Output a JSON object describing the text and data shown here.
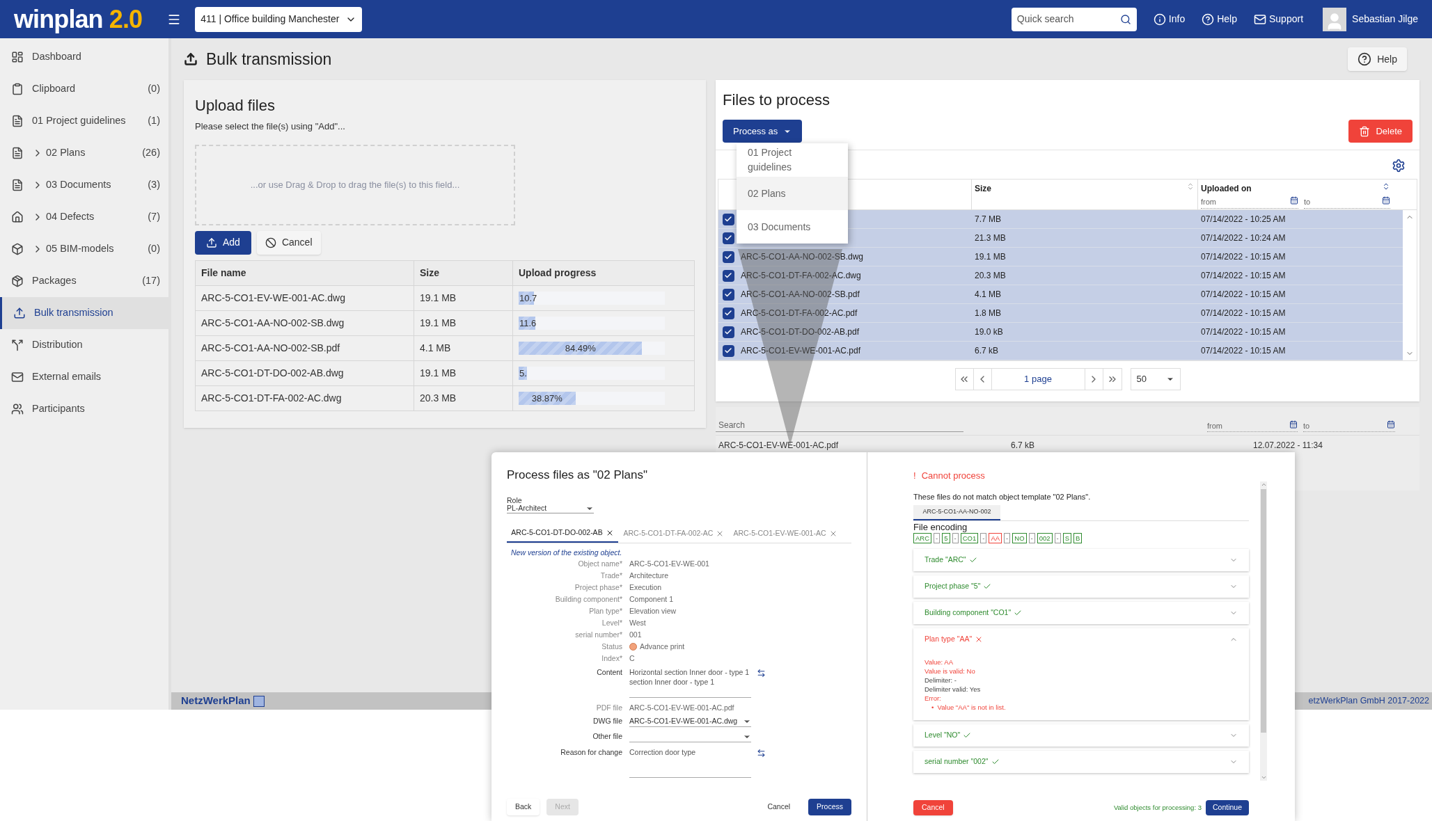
{
  "header": {
    "logo": "winplan",
    "logo_version": "2.0",
    "project": "411 | Office building Manchester",
    "search_placeholder": "Quick search",
    "links": [
      "Info",
      "Help",
      "Support"
    ],
    "user": "Sebastian Jilge"
  },
  "sidebar": {
    "items": [
      {
        "label": "Dashboard",
        "expandable": false,
        "selected": false
      },
      {
        "label": "Clipboard",
        "count": "(0)",
        "expandable": false,
        "selected": false
      },
      {
        "label": "01 Project guidelines",
        "count": "(1)",
        "expandable": false,
        "selected": false
      },
      {
        "label": "02 Plans",
        "count": "(26)",
        "expandable": true,
        "selected": false
      },
      {
        "label": "03 Documents",
        "count": "(3)",
        "expandable": true,
        "selected": false
      },
      {
        "label": "04 Defects",
        "count": "(7)",
        "expandable": true,
        "selected": false
      },
      {
        "label": "05 BIM-models",
        "count": "(0)",
        "expandable": true,
        "selected": false
      },
      {
        "label": "Packages",
        "count": "(17)",
        "expandable": false,
        "selected": false
      },
      {
        "label": "Bulk transmission",
        "expandable": false,
        "selected": true
      },
      {
        "label": "Distribution",
        "expandable": false,
        "selected": false
      },
      {
        "label": "External emails",
        "expandable": false,
        "selected": false
      },
      {
        "label": "Participants",
        "expandable": false,
        "selected": false
      }
    ]
  },
  "page": {
    "title": "Bulk transmission",
    "help": "Help"
  },
  "upload": {
    "title": "Upload files",
    "hint": "Please select the file(s) using \"Add\"...",
    "drop_text": "...or use Drag & Drop to drag the file(s) to this field...",
    "add": "Add",
    "cancel": "Cancel",
    "columns": [
      "File name",
      "Size",
      "Upload progress"
    ],
    "rows": [
      {
        "name": "ARC-5-CO1-EV-WE-001-AC.dwg",
        "size": "19.1 MB",
        "level": 0.107,
        "reading": "10.7"
      },
      {
        "name": "ARC-5-CO1-AA-NO-002-SB.dwg",
        "size": "19.1 MB",
        "level": 0.116,
        "reading": "11.6"
      },
      {
        "name": "ARC-5-CO1-AA-NO-002-SB.pdf",
        "size": "4.1 MB",
        "level": 0.8449,
        "reading": "84.49%"
      },
      {
        "name": "ARC-5-CO1-DT-DO-002-AB.dwg",
        "size": "19.1 MB",
        "level": 0.059,
        "reading": "5."
      },
      {
        "name": "ARC-5-CO1-DT-FA-002-AC.dwg",
        "size": "20.3 MB",
        "level": 0.3887,
        "reading": "38.87%"
      }
    ]
  },
  "files": {
    "title": "Files to process",
    "process_as": "Process as",
    "delete": "Delete",
    "columns": [
      {
        "label": "Size"
      },
      {
        "label": "Uploaded on",
        "from": "from",
        "to": "to"
      }
    ],
    "rows": [
      {
        "checked": true,
        "size": "7.7 MB",
        "uploaded": "07/14/2022 - 10:25 AM"
      },
      {
        "checked": true,
        "size": "21.3 MB",
        "uploaded": "07/14/2022 - 10:24 AM"
      },
      {
        "checked": true,
        "name": "ARC-5-CO1-AA-NO-002-SB.dwg",
        "size": "19.1 MB",
        "uploaded": "07/14/2022 - 10:15 AM"
      },
      {
        "checked": true,
        "name": "ARC-5-CO1-DT-FA-002-AC.dwg",
        "size": "20.3 MB",
        "uploaded": "07/14/2022 - 10:15 AM"
      },
      {
        "checked": true,
        "name": "ARC-5-CO1-AA-NO-002-SB.pdf",
        "size": "4.1 MB",
        "uploaded": "07/14/2022 - 10:15 AM"
      },
      {
        "checked": true,
        "name": "ARC-5-CO1-DT-FA-002-AC.pdf",
        "size": "1.8 MB",
        "uploaded": "07/14/2022 - 10:15 AM"
      },
      {
        "checked": true,
        "name": "ARC-5-CO1-DT-DO-002-AB.pdf",
        "size": "19.0 kB",
        "uploaded": "07/14/2022 - 10:15 AM"
      },
      {
        "checked": true,
        "name": "ARC-5-CO1-EV-WE-001-AC.pdf",
        "size": "6.7 kB",
        "uploaded": "07/14/2022 - 10:15 AM"
      }
    ],
    "pager": "1 page",
    "page_size": "50"
  },
  "process_menu": [
    {
      "label": "01 Project guidelines",
      "selected": false
    },
    {
      "label": "02 Plans",
      "selected": true
    },
    {
      "label": "03 Documents",
      "selected": false
    }
  ],
  "background_table": {
    "search_placeholder": "Search",
    "from": "from",
    "to": "to",
    "row": {
      "name": "ARC-5-CO1-EV-WE-001-AC.pdf",
      "size": "6.7 kB",
      "uploaded": "12.07.2022 - 11:34"
    }
  },
  "dialog": {
    "title": "Process files as \"02 Plans\"",
    "role_label": "Role",
    "role": "PL-Architect",
    "tabs": [
      {
        "label": "ARC-5-CO1-DT-DO-002-AB",
        "selected": true
      },
      {
        "label": "ARC-5-CO1-DT-FA-002-AC",
        "selected": false
      },
      {
        "label": "ARC-5-CO1-EV-WE-001-AC",
        "selected": false
      }
    ],
    "note": "New version of the existing object.",
    "fields": [
      {
        "kind": "text",
        "label": "Object name*",
        "value": "ARC-5-CO1-EV-WE-001"
      },
      {
        "kind": "text",
        "label": "Trade*",
        "value": "Architecture"
      },
      {
        "kind": "text",
        "label": "Project phase*",
        "value": "Execution"
      },
      {
        "kind": "text",
        "label": "Building component*",
        "value": "Component 1"
      },
      {
        "kind": "text",
        "label": "Plan type*",
        "value": "Elevation view"
      },
      {
        "kind": "text",
        "label": "Level*",
        "value": "West"
      },
      {
        "kind": "text",
        "label": "serial number*",
        "value": "001"
      },
      {
        "kind": "status",
        "label": "Status",
        "value": "Advance print"
      },
      {
        "kind": "text",
        "label": "Index*",
        "value": "C"
      },
      {
        "kind": "textarea",
        "label": "Content",
        "value": "Horizontal section Inner door - type 1\nsection Inner door - type 1"
      },
      {
        "kind": "text",
        "label": "PDF file",
        "value": "ARC-5-CO1-EV-WE-001-AC.pdf"
      },
      {
        "kind": "select",
        "label": "DWG file",
        "value": "ARC-5-CO1-EV-WE-001-AC.dwg"
      },
      {
        "kind": "select",
        "label": "Other file"
      },
      {
        "kind": "textarea",
        "label": "Reason for change",
        "value": "Correction door type"
      }
    ],
    "back": "Back",
    "next": "Next",
    "next_disabled": true,
    "cancel": "Cancel",
    "process": "Process"
  },
  "validation": {
    "mark": "!",
    "title": "Cannot process",
    "message": "These files do not match object template \"02 Plans\".",
    "file_tab": "ARC-5-CO1-AA-NO-002",
    "encoding_title": "File encoding",
    "segments": [
      {
        "kind": "segment",
        "text": "ARC",
        "valid": true
      },
      {
        "kind": "delimiter",
        "text": "-"
      },
      {
        "kind": "segment",
        "text": "5",
        "valid": true
      },
      {
        "kind": "delimiter",
        "text": "-"
      },
      {
        "kind": "segment",
        "text": "CO1",
        "valid": true
      },
      {
        "kind": "delimiter",
        "text": "-"
      },
      {
        "kind": "segment",
        "text": "AA",
        "valid": false
      },
      {
        "kind": "delimiter",
        "text": "-"
      },
      {
        "kind": "segment",
        "text": "NO",
        "valid": true
      },
      {
        "kind": "delimiter",
        "text": "-"
      },
      {
        "kind": "segment",
        "text": "002",
        "valid": true
      },
      {
        "kind": "delimiter",
        "text": "-"
      },
      {
        "kind": "segment",
        "text": "S",
        "valid": true
      },
      {
        "kind": "segment",
        "text": "B",
        "valid": true
      }
    ],
    "checks": [
      {
        "label": "Trade \"ARC\"",
        "valid": true,
        "expanded": false
      },
      {
        "label": "Project phase \"5\"",
        "valid": true,
        "expanded": false
      },
      {
        "label": "Building component \"CO1\"",
        "valid": true,
        "expanded": false
      },
      {
        "label": "Plan type \"AA\"",
        "valid": false,
        "expanded": true,
        "details": [
          {
            "kind": "line",
            "text": "Value: AA",
            "valid": false
          },
          {
            "kind": "line",
            "text": "Value is valid: No",
            "valid": false
          },
          {
            "kind": "line",
            "text": "Delimiter: -",
            "valid": true
          },
          {
            "kind": "line",
            "text": "Delimiter valid: Yes",
            "valid": true
          },
          {
            "kind": "line",
            "text": "Error:",
            "valid": false
          },
          {
            "kind": "bullet",
            "marker": "•",
            "text": "Value \"AA\" is not in list.",
            "valid": false
          }
        ]
      },
      {
        "label": "Level \"NO\"",
        "valid": true,
        "expanded": false
      },
      {
        "label": "serial number \"002\"",
        "valid": true,
        "expanded": false
      }
    ],
    "cancel": "Cancel",
    "valid_count": "Valid objects for processing: 3",
    "continue": "Continue"
  },
  "footer": {
    "brand": "NetzWerkPlan",
    "copyright": "etzWerkPlan GmbH 2017-2022"
  }
}
